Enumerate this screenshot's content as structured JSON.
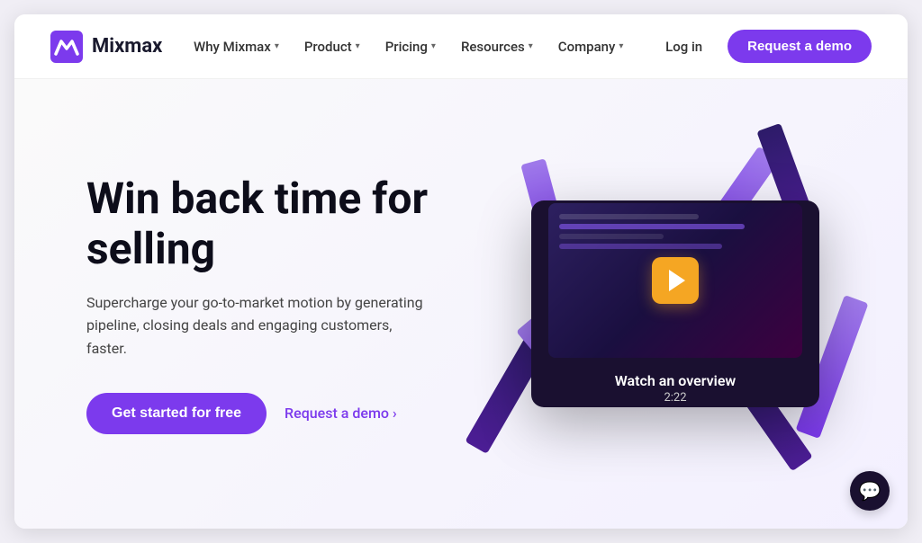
{
  "brand": {
    "name": "Mixmax",
    "logo_alt": "Mixmax Logo"
  },
  "nav": {
    "links": [
      {
        "label": "Why Mixmax",
        "has_dropdown": true
      },
      {
        "label": "Product",
        "has_dropdown": true
      },
      {
        "label": "Pricing",
        "has_dropdown": true
      },
      {
        "label": "Resources",
        "has_dropdown": true
      },
      {
        "label": "Company",
        "has_dropdown": true
      }
    ],
    "login_label": "Log in",
    "demo_label": "Request a demo"
  },
  "hero": {
    "title": "Win back time for selling",
    "subtitle": "Supercharge your go-to-market motion by generating pipeline, closing deals and engaging customers, faster.",
    "cta_primary": "Get started for free",
    "cta_secondary": "Request a demo ›"
  },
  "video": {
    "watch_label": "Watch an overview",
    "duration": "2:22",
    "play_icon": "▶"
  },
  "colors": {
    "brand_purple": "#7c3aed",
    "nav_text": "#333333",
    "hero_title": "#0d0d1a",
    "hero_subtitle": "#444444"
  }
}
